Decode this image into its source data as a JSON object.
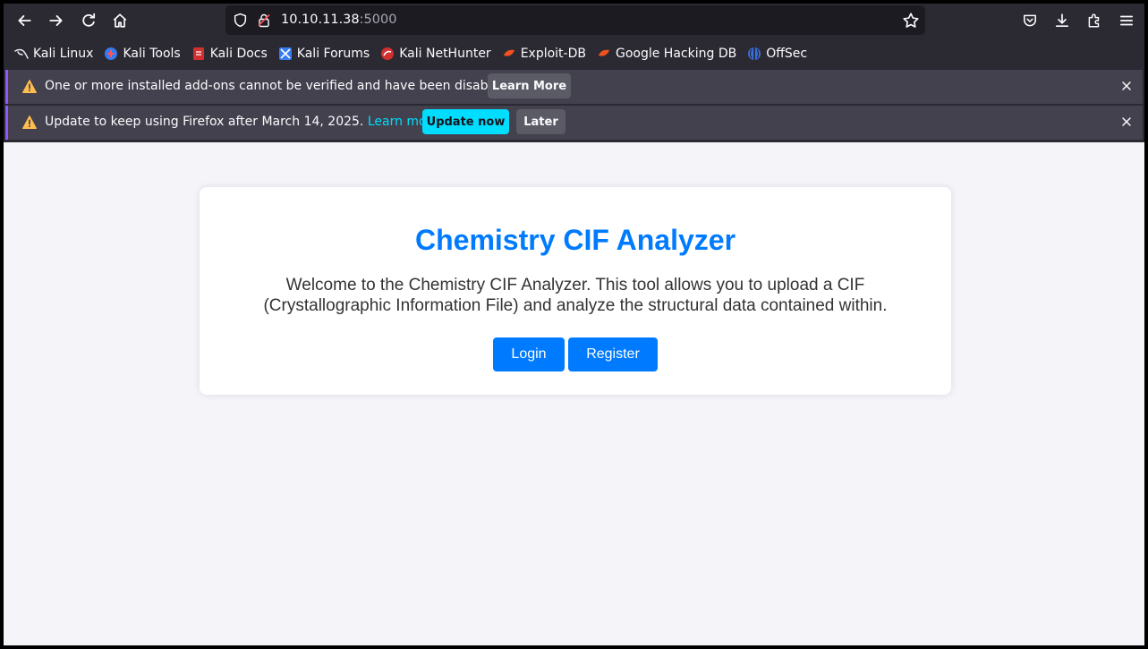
{
  "browser": {
    "url_host": "10.10.11.38",
    "url_port": ":5000",
    "icons": [
      "back-icon",
      "forward-icon",
      "reload-icon",
      "home-icon",
      "shield-icon",
      "lock-icon",
      "star-icon",
      "pocket-icon",
      "download-icon",
      "extensions-icon",
      "menu-icon"
    ]
  },
  "bookmarks": [
    {
      "label": "Kali Linux"
    },
    {
      "label": "Kali Tools"
    },
    {
      "label": "Kali Docs"
    },
    {
      "label": "Kali Forums"
    },
    {
      "label": "Kali NetHunter"
    },
    {
      "label": "Exploit-DB"
    },
    {
      "label": "Google Hacking DB"
    },
    {
      "label": "OffSec"
    }
  ],
  "notifications": [
    {
      "message": "One or more installed add-ons cannot be verified and have been disabled.",
      "button": "Learn More"
    },
    {
      "message": "Update to keep using Firefox after March 14, 2025.",
      "link": "Learn more",
      "primary_button": "Update now",
      "secondary_button": "Later"
    }
  ],
  "page": {
    "title": "Chemistry CIF Analyzer",
    "description": "Welcome to the Chemistry CIF Analyzer. This tool allows you to upload a CIF (Crystallographic Information File) and analyze the structural data contained within.",
    "login_label": "Login",
    "register_label": "Register"
  },
  "colors": {
    "accent": "#007bff",
    "toolbar": "#2b2a33",
    "notification": "#42414d",
    "link": "#00ddff"
  }
}
